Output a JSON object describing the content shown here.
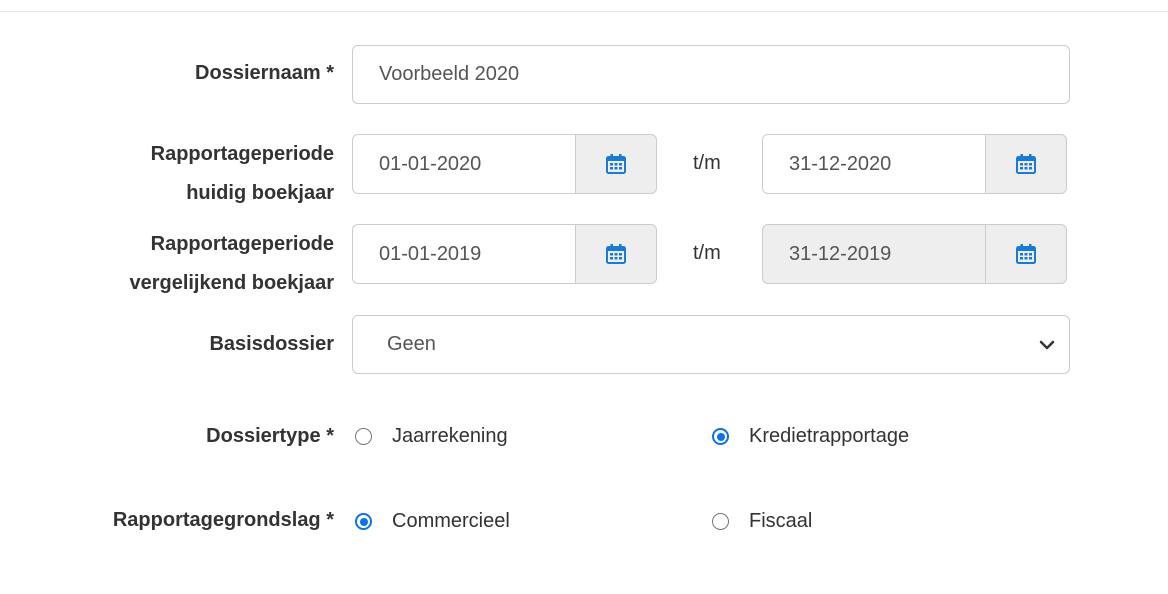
{
  "form": {
    "dossiernaam": {
      "label": "Dossiernaam *",
      "value": "Voorbeeld 2020"
    },
    "huidig": {
      "label_line1": "Rapportageperiode",
      "label_line2": "huidig boekjaar",
      "from": "01-01-2020",
      "separator": "t/m",
      "to": "31-12-2020"
    },
    "vergelijkend": {
      "label_line1": "Rapportageperiode",
      "label_line2": "vergelijkend boekjaar",
      "from": "01-01-2019",
      "separator": "t/m",
      "to": "31-12-2019"
    },
    "basisdossier": {
      "label": "Basisdossier",
      "selected": "Geen"
    },
    "dossiertype": {
      "label": "Dossiertype *",
      "options": [
        {
          "label": "Jaarrekening",
          "checked": false
        },
        {
          "label": "Kredietrapportage",
          "checked": true
        }
      ]
    },
    "grondslag": {
      "label": "Rapportagegrondslag *",
      "options": [
        {
          "label": "Commercieel",
          "checked": true
        },
        {
          "label": "Fiscaal",
          "checked": false
        }
      ]
    }
  },
  "colors": {
    "accent": "#0b72e7",
    "calendar_icon": "#1a7bd6",
    "border": "#cccccc",
    "disabled_bg": "#eeeeee"
  },
  "icons": {
    "calendar": "calendar-icon",
    "select": "chevron-down-icon"
  }
}
